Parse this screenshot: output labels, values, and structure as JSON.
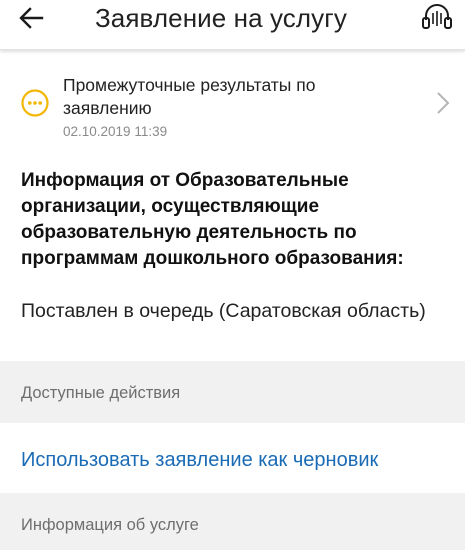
{
  "appbar": {
    "title": "Заявление на услугу",
    "back_icon": "arrow-left-icon",
    "support_icon": "headset-icon"
  },
  "status": {
    "icon": "ellipsis-circle-icon",
    "title": "Промежуточные результаты по заявлению",
    "date": "02.10.2019 11:39",
    "accent_color": "#f2b705"
  },
  "info": {
    "heading": "Информация от Образовательные организации, осуществляющие образовательную деятельность по программам дошкольного образования:",
    "value": "Поставлен в очередь (Саратовская область)"
  },
  "sections": {
    "actions_header": "Доступные действия",
    "action_link": "Использовать заявление как черновик",
    "service_info_header": "Информация об услуге"
  },
  "colors": {
    "link": "#1a6bb5",
    "section_bg": "#f1f1f1"
  }
}
